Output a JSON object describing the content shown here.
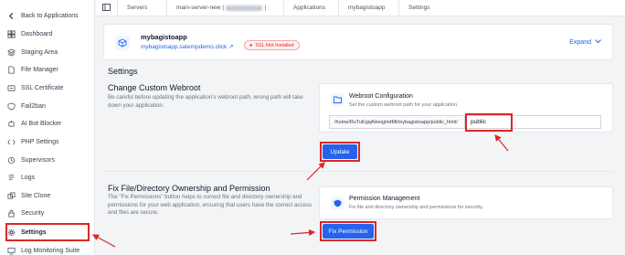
{
  "sidebar": {
    "back_label": "Back to Applications",
    "items": [
      {
        "label": "Dashboard",
        "icon": "dashboard-icon"
      },
      {
        "label": "Staging Area",
        "icon": "staging-icon"
      },
      {
        "label": "File Manager",
        "icon": "file-icon"
      },
      {
        "label": "SSL Certificate",
        "icon": "ssl-icon"
      },
      {
        "label": "Fail2ban",
        "icon": "shield-icon"
      },
      {
        "label": "AI Bot Blocker",
        "icon": "bot-icon"
      },
      {
        "label": "PHP Settings",
        "icon": "php-icon"
      },
      {
        "label": "Supervisors",
        "icon": "supervisor-icon"
      },
      {
        "label": "Logs",
        "icon": "logs-icon"
      },
      {
        "label": "Site Clone",
        "icon": "clone-icon"
      },
      {
        "label": "Security",
        "icon": "lock-icon"
      },
      {
        "label": "Settings",
        "icon": "gear-icon"
      },
      {
        "label": "Log Monitoring Suite",
        "icon": "monitor-icon"
      }
    ],
    "active": "Settings"
  },
  "breadcrumb": {
    "servers": "Servers",
    "server_name": "main-server-new (",
    "server_name_end": ")",
    "applications": "Applications",
    "app": "mybagistoapp",
    "settings": "Settings"
  },
  "app": {
    "name": "mybagistoapp",
    "url": "mybagistoapp.satempdemo.click",
    "ssl_status": "SSL Not Installed",
    "expand_label": "Expand"
  },
  "settings": {
    "title": "Settings",
    "webroot": {
      "title": "Change Custom Webroot",
      "description": "Be careful before updating the application's webroot path, wrong path will take down your application.",
      "card_title": "Webroot Configuration",
      "card_subtitle": "Set the custom webroot path for your application.",
      "path_prefix": "/home/RuTuKgqAHeqjmdMl/mybagistoapp/public_html/",
      "input_value": "public",
      "button_label": "Update"
    },
    "permission": {
      "title": "Fix File/Directory Ownership and Permission",
      "description": "The \"Fix Permissions\" button helps to correct file and directory ownership and permissions for your web application, ensuring that users have the correct access and files are secure.",
      "card_title": "Permission Management",
      "card_subtitle": "Fix file and directory ownership and permissions for security.",
      "button_label": "Fix Permission"
    }
  },
  "colors": {
    "accent": "#2563eb",
    "highlight": "#dc2626",
    "ssl_error": "#dc2626"
  }
}
